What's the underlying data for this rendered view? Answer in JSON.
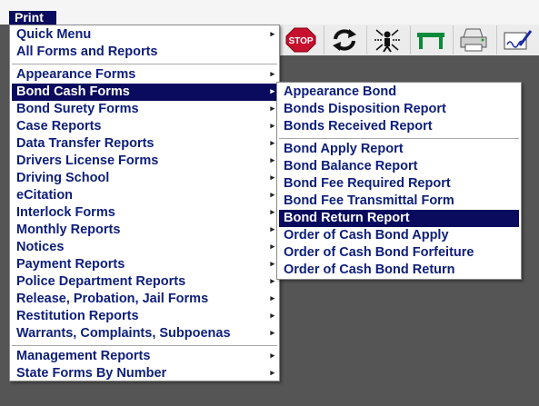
{
  "menubar": {
    "title": "Print"
  },
  "toolbar": {
    "buttons": [
      {
        "icon": "stop-icon",
        "label": "STOP"
      },
      {
        "icon": "refresh-icon"
      },
      {
        "icon": "network-person-icon"
      },
      {
        "icon": "table-icon"
      },
      {
        "icon": "printer-icon"
      },
      {
        "icon": "signature-icon"
      }
    ]
  },
  "main_menu": {
    "groups": [
      [
        {
          "label": "Quick Menu",
          "submenu": true
        },
        {
          "label": "All Forms and Reports",
          "submenu": false
        }
      ],
      [
        {
          "label": "Appearance Forms",
          "submenu": true
        },
        {
          "label": "Bond Cash Forms",
          "submenu": true,
          "selected": true
        },
        {
          "label": "Bond Surety Forms",
          "submenu": true
        },
        {
          "label": "Case Reports",
          "submenu": true
        },
        {
          "label": "Data Transfer Reports",
          "submenu": true
        },
        {
          "label": "Drivers License Forms",
          "submenu": true
        },
        {
          "label": "Driving School",
          "submenu": true
        },
        {
          "label": "eCitation",
          "submenu": true
        },
        {
          "label": "Interlock Forms",
          "submenu": true
        },
        {
          "label": "Monthly Reports",
          "submenu": true
        },
        {
          "label": "Notices",
          "submenu": true
        },
        {
          "label": "Payment Reports",
          "submenu": true
        },
        {
          "label": "Police Department Reports",
          "submenu": true
        },
        {
          "label": "Release, Probation, Jail Forms",
          "submenu": true
        },
        {
          "label": "Restitution Reports",
          "submenu": true
        },
        {
          "label": "Warrants, Complaints, Subpoenas",
          "submenu": true
        }
      ],
      [
        {
          "label": "Management Reports",
          "submenu": true
        },
        {
          "label": "State Forms By Number",
          "submenu": true
        }
      ]
    ]
  },
  "sub_menu": {
    "groups": [
      [
        {
          "label": "Appearance Bond"
        },
        {
          "label": "Bonds Disposition Report"
        },
        {
          "label": "Bonds Received Report"
        }
      ],
      [
        {
          "label": "Bond Apply Report"
        },
        {
          "label": "Bond Balance Report"
        },
        {
          "label": "Bond Fee Required Report"
        },
        {
          "label": "Bond Fee Transmittal Form"
        },
        {
          "label": "Bond Return Report",
          "selected": true
        },
        {
          "label": "Order of Cash Bond Apply"
        },
        {
          "label": "Order of Cash Bond Forfeiture"
        },
        {
          "label": "Order of Cash Bond Return"
        }
      ]
    ]
  },
  "colors": {
    "background": "#555555",
    "menu_text": "#0d1e7a",
    "highlight": "#0a0a5e",
    "stop_red": "#c8102e"
  }
}
